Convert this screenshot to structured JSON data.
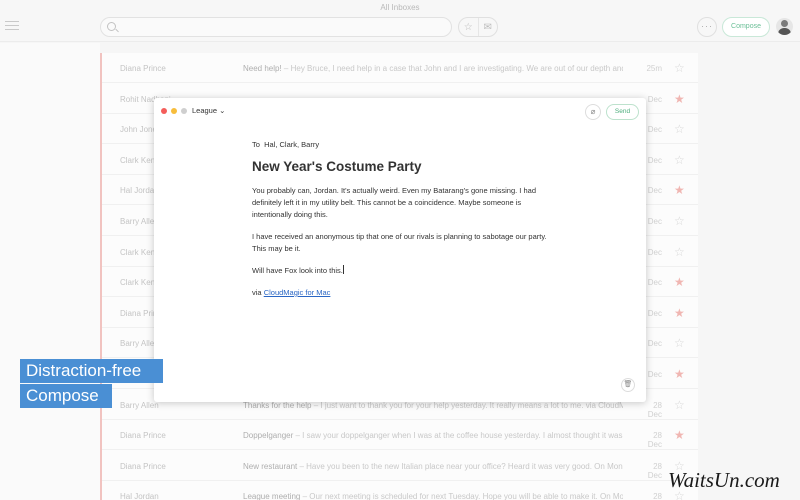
{
  "header": {
    "title": "All Inboxes",
    "compose_label": "Compose",
    "more_label": "···"
  },
  "mail_rows": [
    {
      "from": "Diana Prince",
      "subject": "Need help!",
      "preview": "Hey Bruce, I need help in a case that John and I are investigating. We are out of our depth and could use",
      "date": "25m",
      "starred": false
    },
    {
      "from": "Rohit Nadhani",
      "subject": "",
      "preview": "",
      "date": "Dec",
      "starred": true
    },
    {
      "from": "John Jones",
      "subject": "",
      "preview": "",
      "date": "Dec",
      "starred": false
    },
    {
      "from": "Clark Kent",
      "subject": "",
      "preview": "",
      "date": "Dec",
      "starred": false
    },
    {
      "from": "Hal Jordan",
      "subject": "",
      "preview": "",
      "date": "Dec",
      "starred": true
    },
    {
      "from": "Barry Allen",
      "subject": "",
      "preview": "",
      "date": "Dec",
      "starred": false
    },
    {
      "from": "Clark Kent",
      "subject": "",
      "preview": "",
      "date": "Dec",
      "starred": false
    },
    {
      "from": "Clark Kent",
      "subject": "",
      "preview": "",
      "date": "Dec",
      "starred": true
    },
    {
      "from": "Diana Prince",
      "subject": "",
      "preview": "",
      "date": "Dec",
      "starred": true
    },
    {
      "from": "Barry Allen",
      "subject": "",
      "preview": "",
      "date": "Dec",
      "starred": false
    },
    {
      "from": "",
      "subject": "",
      "preview": "",
      "date": "Dec",
      "starred": true
    },
    {
      "from": "Barry Allen",
      "subject": "Thanks for the help",
      "preview": "I just want to thank you for your help yesterday. It really means a lot to me. via CloudMagic",
      "date": "28 Dec",
      "starred": false
    },
    {
      "from": "Diana Prince",
      "subject": "Doppelganger",
      "preview": "I saw your doppelganger when I was at the coffee house yesterday. I almost thought it was you",
      "date": "28 Dec",
      "starred": true
    },
    {
      "from": "Diana Prince",
      "subject": "New restaurant",
      "preview": "Have you been to the new Italian place near your office? Heard it was very good. On Mon, D",
      "date": "28 Dec",
      "starred": false
    },
    {
      "from": "Hal Jordan",
      "subject": "League meeting",
      "preview": "Our next meeting is scheduled for next Tuesday. Hope you will be able to make it. On Mon, D",
      "date": "28 Dec",
      "starred": false
    }
  ],
  "compose": {
    "account": "League",
    "chevron": "⌄",
    "send_label": "Send",
    "to_label": "To",
    "recipients": "Hal, Clark, Barry",
    "subject": "New Year's Costume Party",
    "paragraphs": [
      "You probably can, Jordan. It's actually weird. Even my Batarang's gone missing. I had definitely left it in my utility belt. This cannot be a coincidence. Maybe someone is intentionally doing this.",
      "I have received an anonymous tip that one of our rivals is planning to sabotage our party. This may be it.",
      "Will have Fox look into this."
    ],
    "signature_prefix": "via",
    "signature_link": "CloudMagic for Mac"
  },
  "banner": {
    "line1": "Distraction-free",
    "line2": "Compose",
    "color": "#4a8fd4"
  },
  "watermark": "WaitsUn.com",
  "colors": {
    "close": "#f45d5a",
    "minimize": "#f7bd3c",
    "zoom": "#cfcfcf",
    "accent_green": "#4cad7c"
  }
}
